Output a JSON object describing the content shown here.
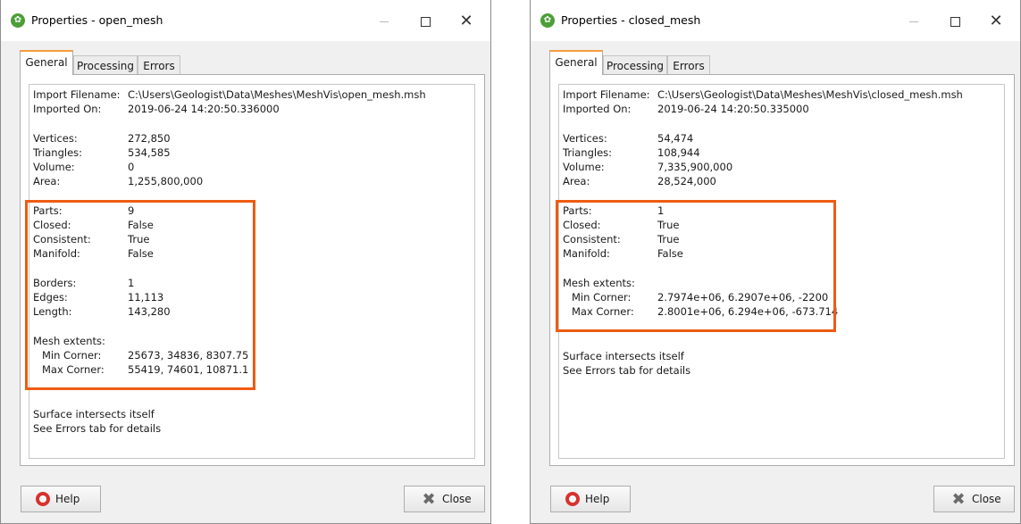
{
  "windows": [
    {
      "title": "Properties - open_mesh",
      "tabs": [
        "General",
        "Processing",
        "Errors"
      ],
      "import_filename_label": "Import Filename:",
      "import_filename": "C:\\Users\\Geologist\\Data\\Meshes\\MeshVis\\open_mesh.msh",
      "imported_on_label": "Imported On:",
      "imported_on": "2019-06-24 14:20:50.336000",
      "vertices_label": "Vertices:",
      "vertices": "272,850",
      "triangles_label": "Triangles:",
      "triangles": "534,585",
      "volume_label": "Volume:",
      "volume": "0",
      "area_label": "Area:",
      "area": "1,255,800,000",
      "parts_label": "Parts:",
      "parts": "9",
      "closed_label": "Closed:",
      "closed": "False",
      "consistent_label": "Consistent:",
      "consistent": "True",
      "manifold_label": "Manifold:",
      "manifold": "False",
      "borders_label": "Borders:",
      "borders": "1",
      "edges_label": "Edges:",
      "edges": "11,113",
      "length_label": "Length:",
      "length": "143,280",
      "mesh_extents_label": "Mesh extents:",
      "min_corner_label": "Min Corner:",
      "min_corner": "25673, 34836, 8307.75",
      "max_corner_label": "Max Corner:",
      "max_corner": "55419, 74601, 10871.1",
      "note1": "Surface intersects itself",
      "note2": "See Errors tab for details",
      "help_label": "Help",
      "close_label": "Close"
    },
    {
      "title": "Properties - closed_mesh",
      "tabs": [
        "General",
        "Processing",
        "Errors"
      ],
      "import_filename_label": "Import Filename:",
      "import_filename": "C:\\Users\\Geologist\\Data\\Meshes\\MeshVis\\closed_mesh.msh",
      "imported_on_label": "Imported On:",
      "imported_on": "2019-06-24 14:20:50.335000",
      "vertices_label": "Vertices:",
      "vertices": "54,474",
      "triangles_label": "Triangles:",
      "triangles": "108,944",
      "volume_label": "Volume:",
      "volume": "7,335,900,000",
      "area_label": "Area:",
      "area": "28,524,000",
      "parts_label": "Parts:",
      "parts": "1",
      "closed_label": "Closed:",
      "closed": "True",
      "consistent_label": "Consistent:",
      "consistent": "True",
      "manifold_label": "Manifold:",
      "manifold": "False",
      "mesh_extents_label": "Mesh extents:",
      "min_corner_label": "Min Corner:",
      "min_corner": "2.7974e+06, 6.2907e+06, -2200",
      "max_corner_label": "Max Corner:",
      "max_corner": "2.8001e+06, 6.294e+06, -673.714",
      "note1": "Surface intersects itself",
      "note2": "See Errors tab for details",
      "help_label": "Help",
      "close_label": "Close"
    }
  ],
  "colors": {
    "highlight": "#ee5b12",
    "active_tab": "#f39c3a",
    "help_icon": "#d8322e"
  },
  "icons": {
    "app": "app-logo-icon",
    "help": "lifebuoy-icon",
    "close": "close-x-icon"
  }
}
